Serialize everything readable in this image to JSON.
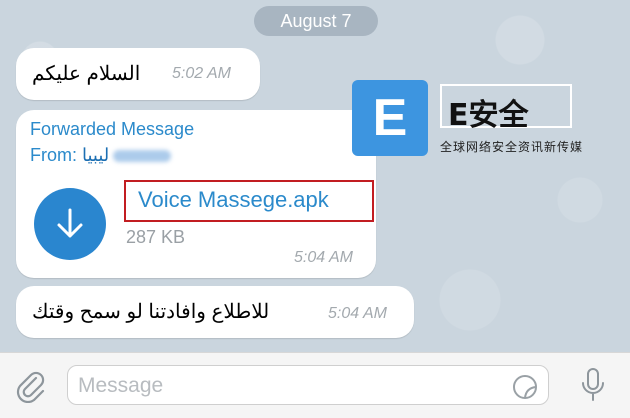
{
  "date_separator": "August 7",
  "messages": [
    {
      "text": "السلام عليكم",
      "time": "5:02 AM"
    },
    {
      "forwarded_label": "Forwarded Message",
      "from_prefix": "From:",
      "from_name": "ليبيا",
      "file": {
        "name": "Voice Massege.apk",
        "size": "287 KB"
      },
      "time": "5:04 AM"
    },
    {
      "text": "للاطلاع وافادتنا لو سمح وقتك",
      "time": "5:04 AM"
    }
  ],
  "composer": {
    "placeholder": "Message"
  },
  "watermark": {
    "logo_letter": "E",
    "title": "E安全",
    "subtitle": "全球网络安全资讯新传媒"
  },
  "colors": {
    "accent": "#2b8acb",
    "highlight_border": "#c21d21",
    "bubble": "#ffffff",
    "background": "#cad5de"
  },
  "icons": [
    "download-icon",
    "paperclip-icon",
    "sticker-icon",
    "microphone-icon"
  ]
}
